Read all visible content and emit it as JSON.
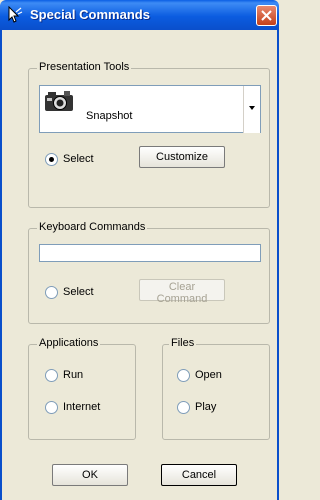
{
  "window": {
    "title": "Special Commands",
    "close_glyph": "✕",
    "app_icon": "cursor-hand-icon"
  },
  "presentation_tools": {
    "legend": "Presentation Tools",
    "selected_tool": "Snapshot",
    "tool_icon": "camera-icon",
    "select_label": "Select",
    "select_checked": true,
    "customize_label": "Customize"
  },
  "keyboard_commands": {
    "legend": "Keyboard Commands",
    "input_value": "",
    "select_label": "Select",
    "select_checked": false,
    "clear_label": "Clear Command",
    "clear_enabled": false
  },
  "applications": {
    "legend": "Applications",
    "options": [
      "Run",
      "Internet"
    ]
  },
  "files": {
    "legend": "Files",
    "options": [
      "Open",
      "Play"
    ]
  },
  "buttons": {
    "ok": "OK",
    "cancel": "Cancel"
  },
  "colors": {
    "titlebar": "#0a5fe4",
    "dialog_bg": "#ece9d8",
    "close_button": "#d9593a"
  }
}
